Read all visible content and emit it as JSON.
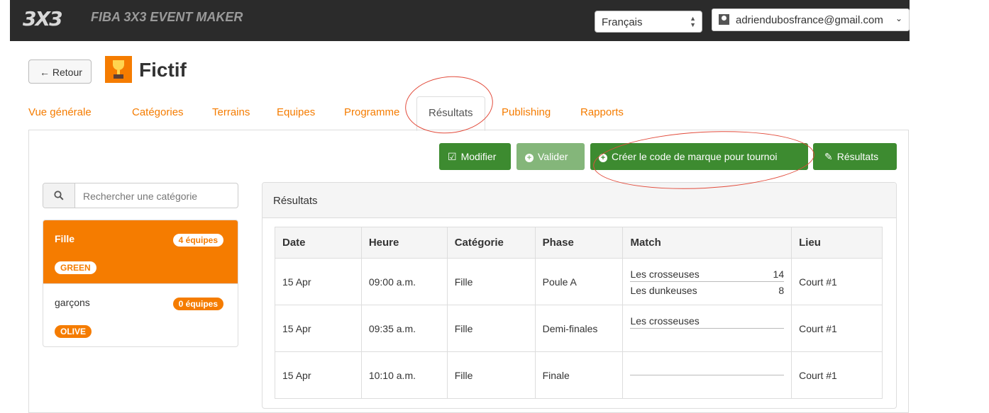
{
  "navbar": {
    "logo_text": "3X3",
    "app_title": "FIBA 3X3 EVENT MAKER",
    "language": "Français",
    "user_email": "adriendubosfrance@gmail.com"
  },
  "header": {
    "back_label": "← Retour",
    "title": "Fictif"
  },
  "tabs": [
    {
      "label": "Vue générale"
    },
    {
      "label": "Catégories"
    },
    {
      "label": "Terrains"
    },
    {
      "label": "Equipes"
    },
    {
      "label": "Programme"
    },
    {
      "label": "Résultats",
      "active": true
    },
    {
      "label": "Publishing"
    },
    {
      "label": "Rapports"
    }
  ],
  "actions": {
    "modifier": "Modifier",
    "valider": "Valider",
    "create_code": "Créer le code de marque pour tournoi",
    "resultats": "Résultats"
  },
  "search": {
    "placeholder": "Rechercher une catégorie"
  },
  "categories": [
    {
      "name": "Fille",
      "teams": "4 équipes",
      "color_tag": "GREEN",
      "active": true
    },
    {
      "name": "garçons",
      "teams": "0 équipes",
      "color_tag": "OLIVE",
      "active": false
    }
  ],
  "results_panel": {
    "heading": "Résultats",
    "columns": [
      "Date",
      "Heure",
      "Catégorie",
      "Phase",
      "Match",
      "Lieu"
    ],
    "rows": [
      {
        "date": "15 Apr",
        "time": "09:00 a.m.",
        "category": "Fille",
        "phase": "Poule A",
        "team1": "Les crosseuses",
        "score1": "14",
        "team2": "Les dunkeuses",
        "score2": "8",
        "venue": "Court #1"
      },
      {
        "date": "15 Apr",
        "time": "09:35 a.m.",
        "category": "Fille",
        "phase": "Demi-finales",
        "team1": "Les crosseuses",
        "score1": "",
        "team2": "",
        "score2": "",
        "venue": "Court #1"
      },
      {
        "date": "15 Apr",
        "time": "10:10 a.m.",
        "category": "Fille",
        "phase": "Finale",
        "team1": "",
        "score1": "",
        "team2": "",
        "score2": "",
        "venue": "Court #1"
      }
    ]
  },
  "colors": {
    "brand_orange": "#f57c00",
    "action_green": "#3d8b30",
    "annotation_red": "#e24b3b"
  }
}
